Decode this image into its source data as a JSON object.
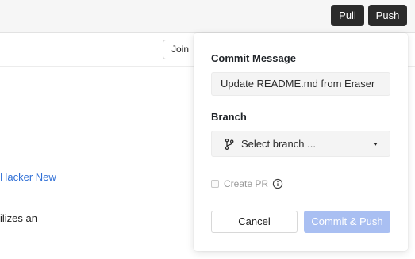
{
  "toolbar": {
    "pull_label": "Pull",
    "push_label": "Push"
  },
  "document": {
    "join_label": "Join",
    "link_text": "Hacker New",
    "body_text": "ilizes an"
  },
  "commit_popover": {
    "message_label": "Commit Message",
    "message_value": "Update README.md from Eraser",
    "branch_label": "Branch",
    "branch_placeholder": "Select branch ...",
    "create_pr_label": "Create PR",
    "create_pr_checked": false,
    "cancel_label": "Cancel",
    "commit_label": "Commit & Push"
  },
  "icons": {
    "branch": "git-branch-icon",
    "caret": "chevron-down-icon",
    "info": "info-icon"
  },
  "colors": {
    "toolbar_button": "#2b2b2b",
    "link": "#2f6fd6",
    "commit_button_disabled": "#a9bff2"
  }
}
